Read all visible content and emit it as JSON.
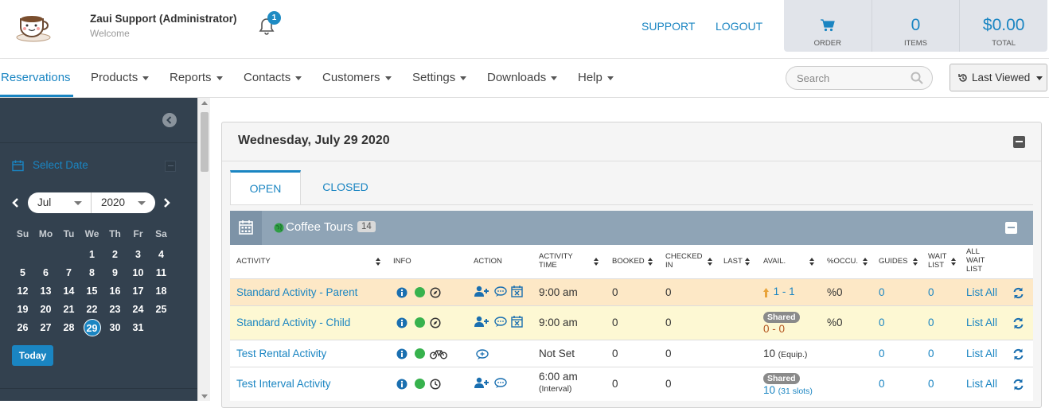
{
  "header": {
    "user_name": "Zaui Support (Administrator)",
    "welcome": "Welcome",
    "notification_count": "1",
    "support_link": "SUPPORT",
    "logout_link": "LOGOUT",
    "cart": {
      "order_label": "ORDER",
      "items_value": "0",
      "items_label": "ITEMS",
      "total_value": "$0.00",
      "total_label": "TOTAL"
    }
  },
  "nav": {
    "items": [
      "Reservations",
      "Products",
      "Reports",
      "Contacts",
      "Customers",
      "Settings",
      "Downloads",
      "Help"
    ],
    "search_placeholder": "Search",
    "last_viewed": "Last Viewed"
  },
  "sidebar": {
    "select_date": "Select Date",
    "month": "Jul",
    "year": "2020",
    "weekdays": [
      "Su",
      "Mo",
      "Tu",
      "We",
      "Th",
      "Fr",
      "Sa"
    ],
    "weeks": [
      [
        "",
        "",
        "",
        "1",
        "2",
        "3",
        "4"
      ],
      [
        "5",
        "6",
        "7",
        "8",
        "9",
        "10",
        "11"
      ],
      [
        "12",
        "13",
        "14",
        "15",
        "16",
        "17",
        "18"
      ],
      [
        "19",
        "20",
        "21",
        "22",
        "23",
        "24",
        "25"
      ],
      [
        "26",
        "27",
        "28",
        "29",
        "30",
        "31",
        ""
      ]
    ],
    "selected_day": "29",
    "today_button": "Today"
  },
  "panel": {
    "date_title": "Wednesday, July 29 2020",
    "tabs": [
      "OPEN",
      "CLOSED"
    ],
    "active_tab": "OPEN",
    "group_name": "Coffee Tours",
    "group_count": "14"
  },
  "table": {
    "columns": [
      "ACTIVITY",
      "INFO",
      "ACTION",
      "ACTIVITY TIME",
      "BOOKED",
      "CHECKED IN",
      "LAST",
      "AVAIL.",
      "%OCCU.",
      "GUIDES",
      "WAIT LIST",
      "ALL WAIT LIST"
    ],
    "rows": [
      {
        "activity": "Standard Activity - Parent",
        "time": "9:00 am",
        "time_sub": "",
        "booked": "0",
        "checked_in": "0",
        "avail_badge": "",
        "avail": "1 - 1",
        "avail_sub": "",
        "occu": "%0",
        "guides": "0",
        "wait": "0",
        "all_wait": "List All",
        "bg": "#fde8c6"
      },
      {
        "activity": "Standard Activity - Child",
        "time": "9:00 am",
        "time_sub": "",
        "booked": "0",
        "checked_in": "0",
        "avail_badge": "Shared",
        "avail": "0 - 0",
        "avail_sub": "",
        "occu": "%0",
        "guides": "0",
        "wait": "0",
        "all_wait": "List All",
        "bg": "#fdf8d3"
      },
      {
        "activity": "Test Rental Activity",
        "time": "Not Set",
        "time_sub": "",
        "booked": "0",
        "checked_in": "0",
        "avail_badge": "",
        "avail": "10",
        "avail_sub": "(Equip.)",
        "occu": "",
        "guides": "0",
        "wait": "0",
        "all_wait": "List All",
        "bg": "#ffffff"
      },
      {
        "activity": "Test Interval Activity",
        "time": "6:00 am",
        "time_sub": "(Interval)",
        "booked": "0",
        "checked_in": "0",
        "avail_badge": "Shared",
        "avail": "10",
        "avail_sub": "(31 slots)",
        "occu": "",
        "guides": "0",
        "wait": "0",
        "all_wait": "List All",
        "bg": "#ffffff"
      }
    ]
  },
  "colors": {
    "accent": "#1a85c2",
    "sidebar": "#33414f",
    "group_header": "#8fa4b6",
    "status_green": "#37b24d"
  }
}
